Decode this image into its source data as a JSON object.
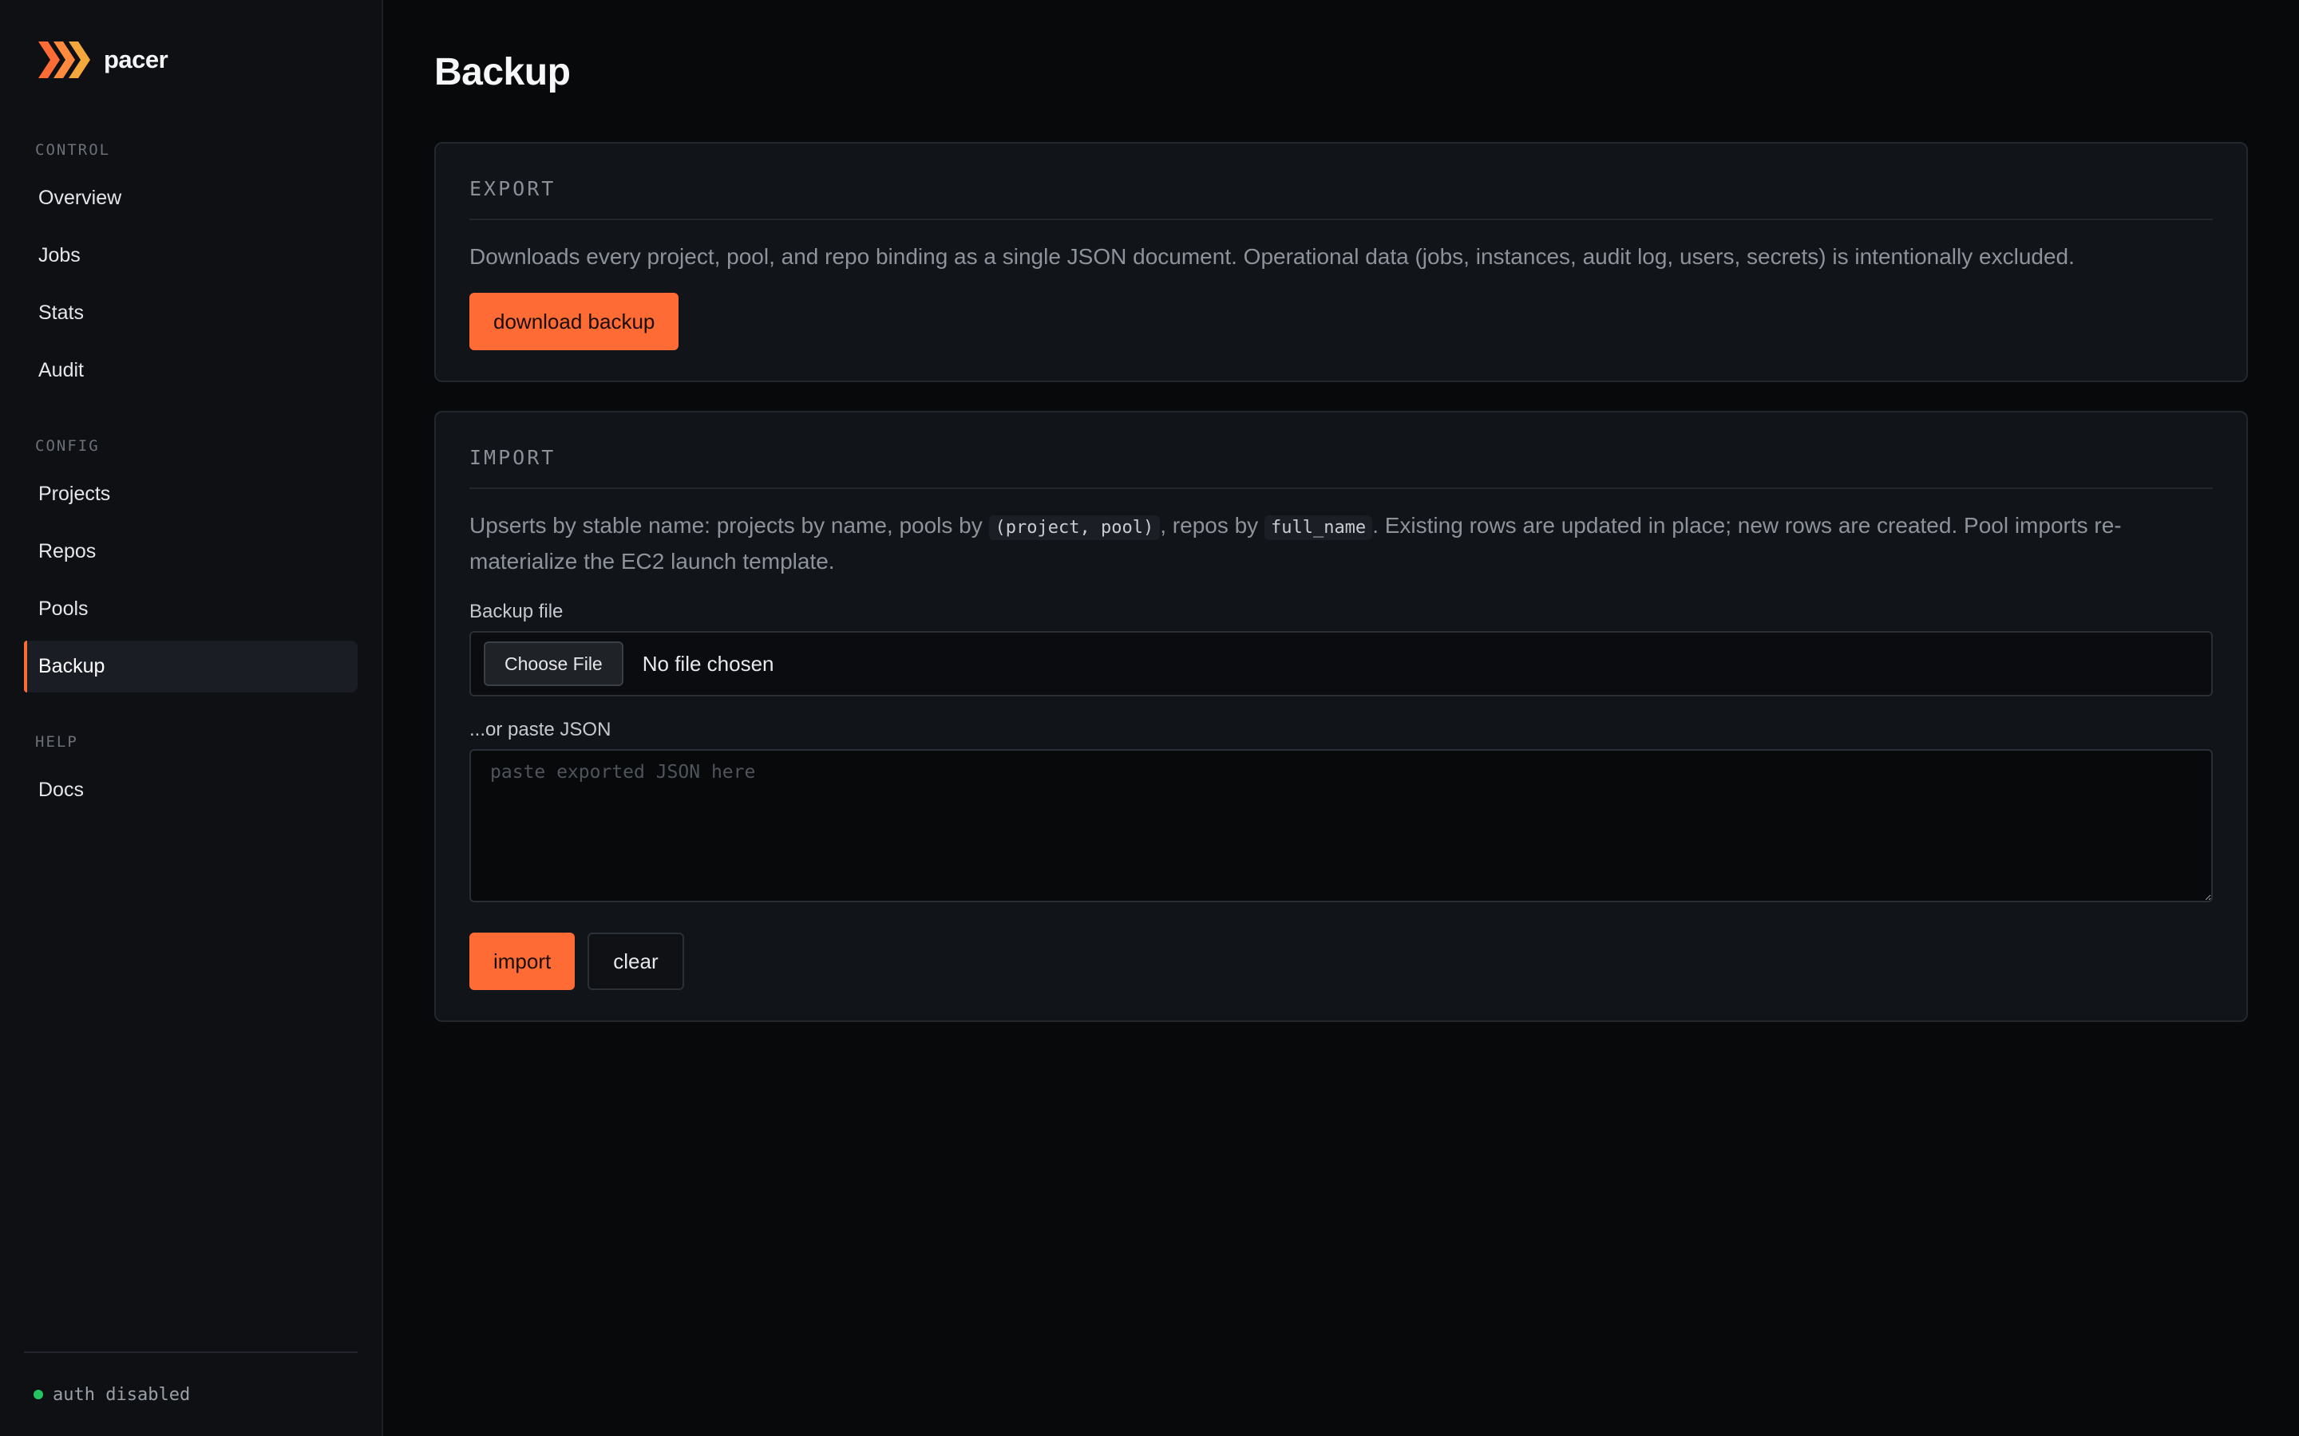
{
  "brand": {
    "name": "pacer",
    "logo_icon": "chevrons-right-logo-icon",
    "accent": "#ff6b35"
  },
  "sidebar": {
    "sections": [
      {
        "heading": "CONTROL",
        "items": [
          "Overview",
          "Jobs",
          "Stats",
          "Audit"
        ]
      },
      {
        "heading": "CONFIG",
        "items": [
          "Projects",
          "Repos",
          "Pools",
          "Backup"
        ]
      },
      {
        "heading": "HELP",
        "items": [
          "Docs"
        ]
      }
    ],
    "active_item": "Backup",
    "footer": {
      "status_text": "auth disabled",
      "status_color": "#22c55e"
    }
  },
  "page": {
    "title": "Backup"
  },
  "export_card": {
    "header": "EXPORT",
    "description": "Downloads every project, pool, and repo binding as a single JSON document. Operational data (jobs, instances, audit log, users, secrets) is intentionally excluded.",
    "button_label": "download backup"
  },
  "import_card": {
    "header": "IMPORT",
    "description_part1": "Upserts by stable name: projects by name, pools by ",
    "code1": "(project, pool)",
    "description_part2": ", repos by ",
    "code2": "full_name",
    "description_part3": ". Existing rows are updated in place; new rows are created. Pool imports re-materialize the EC2 launch template.",
    "file_label": "Backup file",
    "choose_file_label": "Choose File",
    "file_status": "No file chosen",
    "paste_label": "...or paste JSON",
    "paste_placeholder": "paste exported JSON here",
    "paste_value": "",
    "import_label": "import",
    "clear_label": "clear"
  }
}
